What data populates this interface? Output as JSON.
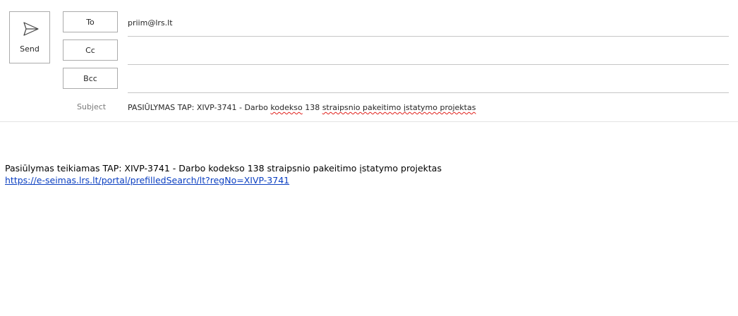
{
  "send": {
    "label": "Send",
    "icon": "send-icon"
  },
  "fields": {
    "to": {
      "label": "To",
      "value": "priim@lrs.lt"
    },
    "cc": {
      "label": "Cc",
      "value": ""
    },
    "bcc": {
      "label": "Bcc",
      "value": ""
    },
    "subject": {
      "label": "Subject",
      "part1": "PASIŪLYMAS TAP: XIVP-3741 - Darbo ",
      "part2": "kodekso",
      "part3": " 138 ",
      "part4": "straipsnio pakeitimo įstatymo projektas"
    }
  },
  "body": {
    "text": "Pasiūlymas teikiamas TAP: XIVP-3741 - Darbo kodekso 138 straipsnio pakeitimo įstatymo projektas",
    "link": "https://e-seimas.lrs.lt/portal/prefilledSearch/lt?regNo=XIVP-3741"
  },
  "colors": {
    "link": "#0b3fc1",
    "spellcheck": "#e0201b"
  }
}
